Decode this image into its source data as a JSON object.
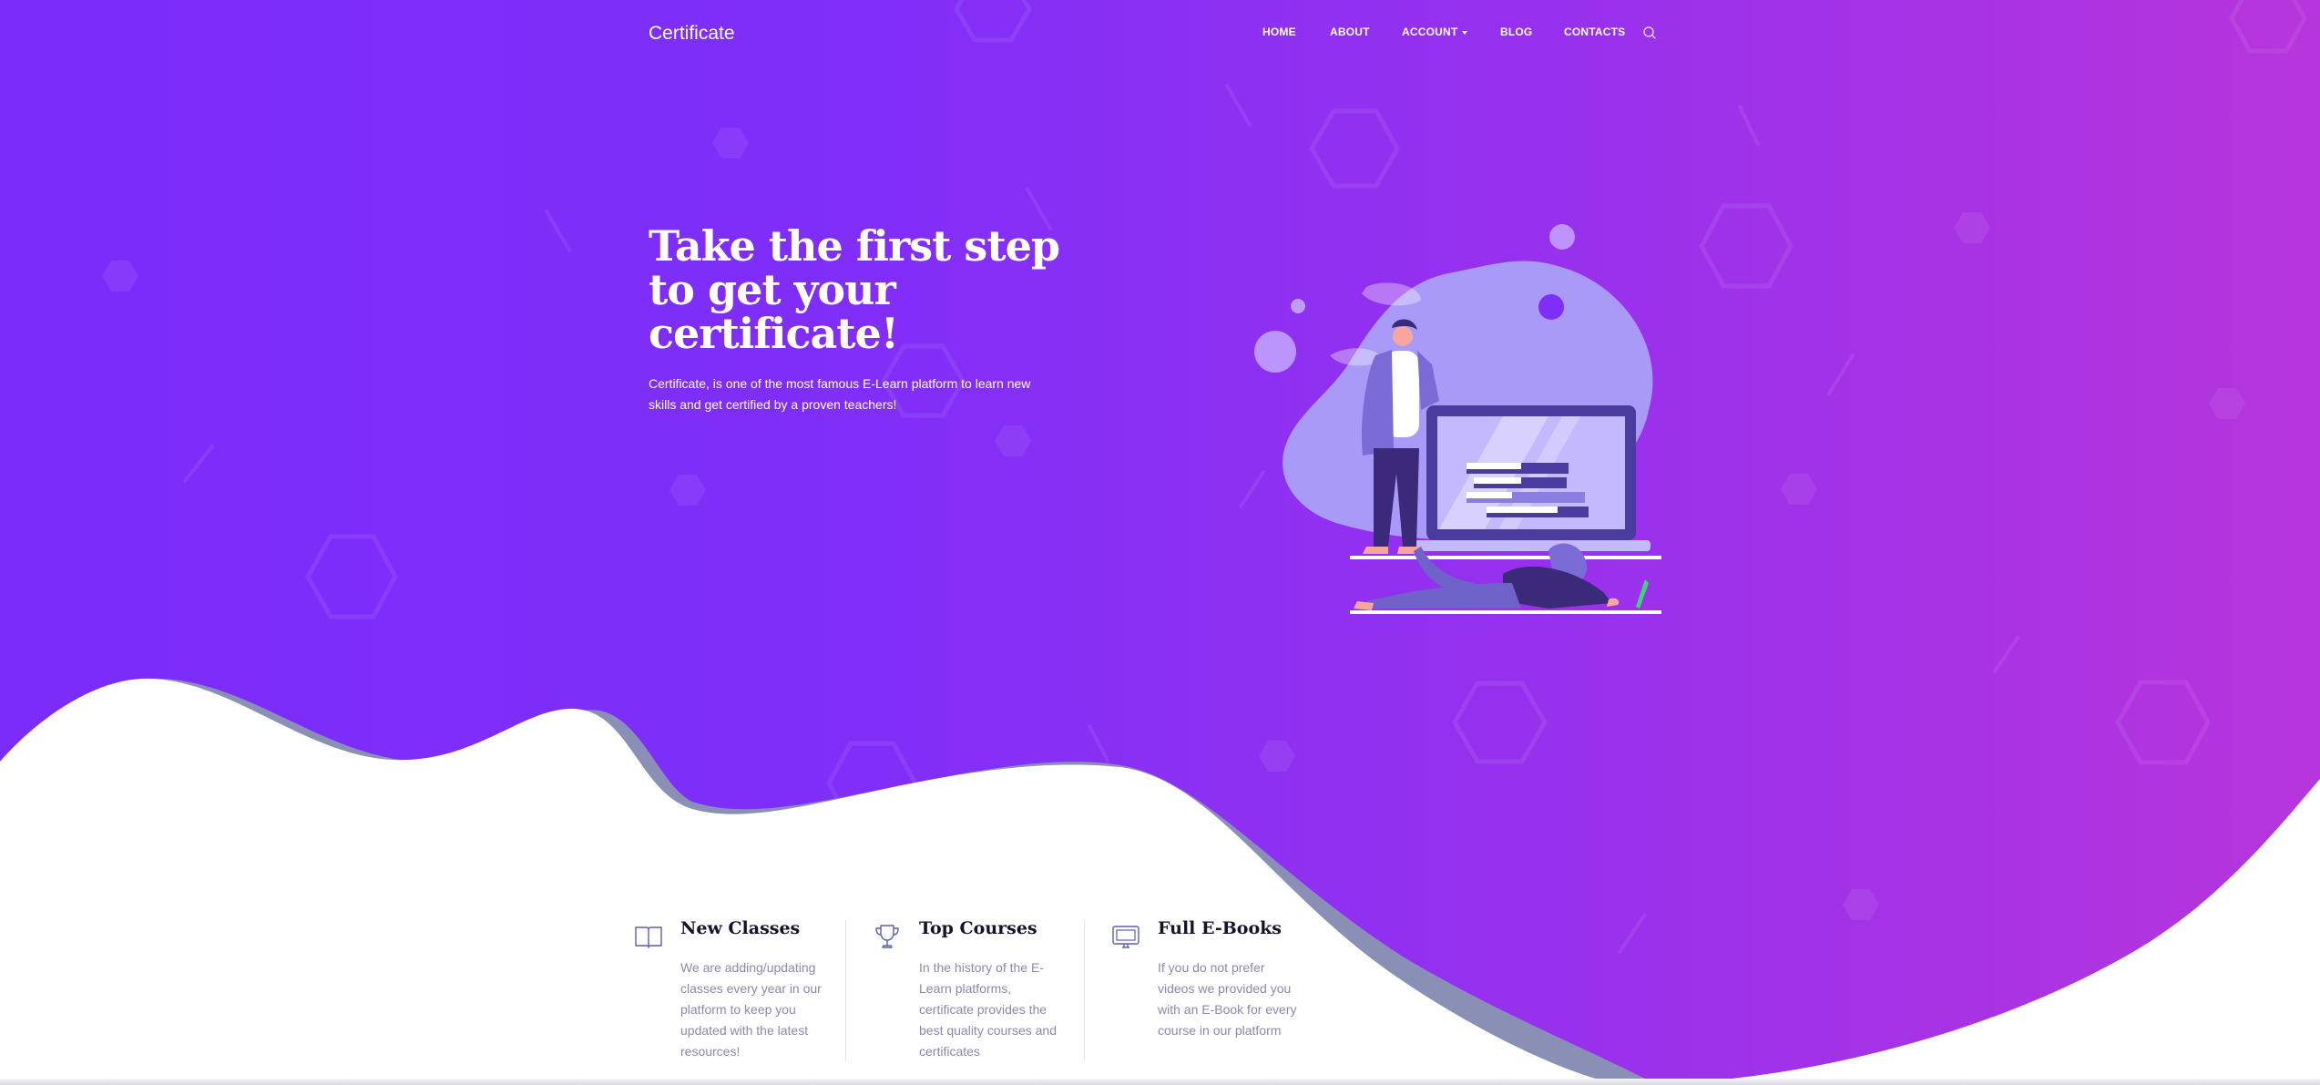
{
  "brand": {
    "name": "Certificate"
  },
  "nav": {
    "items": [
      {
        "label": "HOME"
      },
      {
        "label": "ABOUT"
      },
      {
        "label": "ACCOUNT"
      },
      {
        "label": "BLOG"
      },
      {
        "label": "CONTACTS"
      }
    ],
    "search_icon": "search-icon",
    "account_has_dropdown": true
  },
  "hero": {
    "headline_lines": [
      "Take the first step",
      "to get your",
      "certificate!"
    ],
    "lead": "Certificate, is one of the most famous E-Learn platform to learn new skills and get certified by a proven teachers!"
  },
  "features": [
    {
      "icon": "book-icon",
      "title": "New Classes",
      "text": "We are adding/updating classes every year in our platform to keep you updated with the latest resources!"
    },
    {
      "icon": "trophy-icon",
      "title": "Top Courses",
      "text": "In the history of the E-Learn platforms, certificate provides the best quality courses and certificates"
    },
    {
      "icon": "monitor-icon",
      "title": "Full E-Books",
      "text": "If you do not prefer videos we provided you with an E-Book for every course in our platform"
    }
  ],
  "colors": {
    "gradient_start": "#7c2cfa",
    "gradient_end": "#b735dc",
    "heading_dark": "#14132b",
    "muted_text": "#8a89ad",
    "wave_shadow": "#8a8fb5"
  }
}
